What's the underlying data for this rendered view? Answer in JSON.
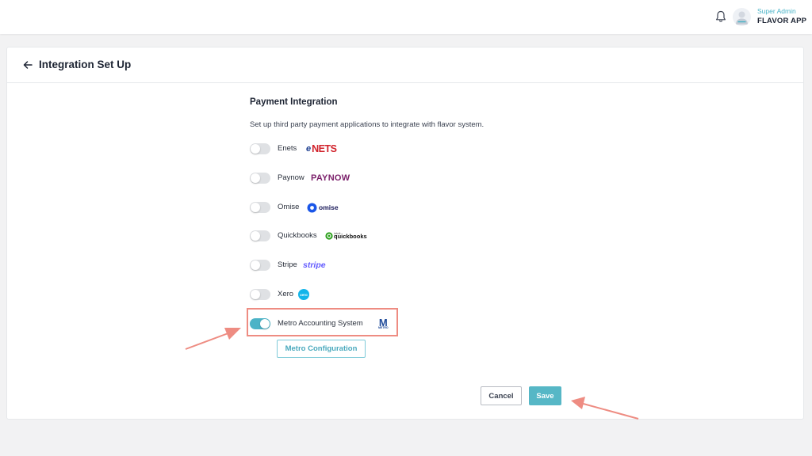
{
  "header": {
    "user_role": "Super Admin",
    "app_name": "FLAVOR APP",
    "icons": {
      "notification": "bell-icon",
      "profile": "avatar-icon"
    }
  },
  "page": {
    "title": "Integration Set Up",
    "back_icon": "arrow-left-icon"
  },
  "section": {
    "title": "Payment Integration",
    "description": "Set up third party payment applications to integrate with flavor system."
  },
  "integrations": [
    {
      "label": "Enets",
      "enabled": false,
      "logo_text": "NETS",
      "logo_prefix": "e",
      "logo_color": "#d1222b",
      "logo_prefix_color": "#1b3d8f"
    },
    {
      "label": "Paynow",
      "enabled": false,
      "logo_text": "PAYNOW",
      "logo_color": "#7b1f6a"
    },
    {
      "label": "Omise",
      "enabled": false,
      "logo_text": "omise",
      "logo_color": "#1a1a5a",
      "logo_icon_color": "#1a56e8"
    },
    {
      "label": "Quickbooks",
      "enabled": false,
      "logo_text": "quickbooks",
      "logo_prefix": "intuit",
      "logo_color": "#111111",
      "logo_icon_color": "#2ca01c"
    },
    {
      "label": "Stripe",
      "enabled": false,
      "logo_text": "stripe",
      "logo_color": "#635bff"
    },
    {
      "label": "Xero",
      "enabled": false,
      "logo_text": "xero",
      "logo_color": "#ffffff",
      "logo_icon_color": "#13b5ea"
    },
    {
      "label": "Metro Accounting System",
      "enabled": true,
      "logo_text": "M",
      "logo_sub": "METRO",
      "logo_color": "#1e4a9a"
    }
  ],
  "buttons": {
    "metro_configuration": "Metro Configuration",
    "cancel": "Cancel",
    "save": "Save"
  },
  "colors": {
    "accent": "#4cb3c7",
    "annotation": "#ee8c82"
  }
}
